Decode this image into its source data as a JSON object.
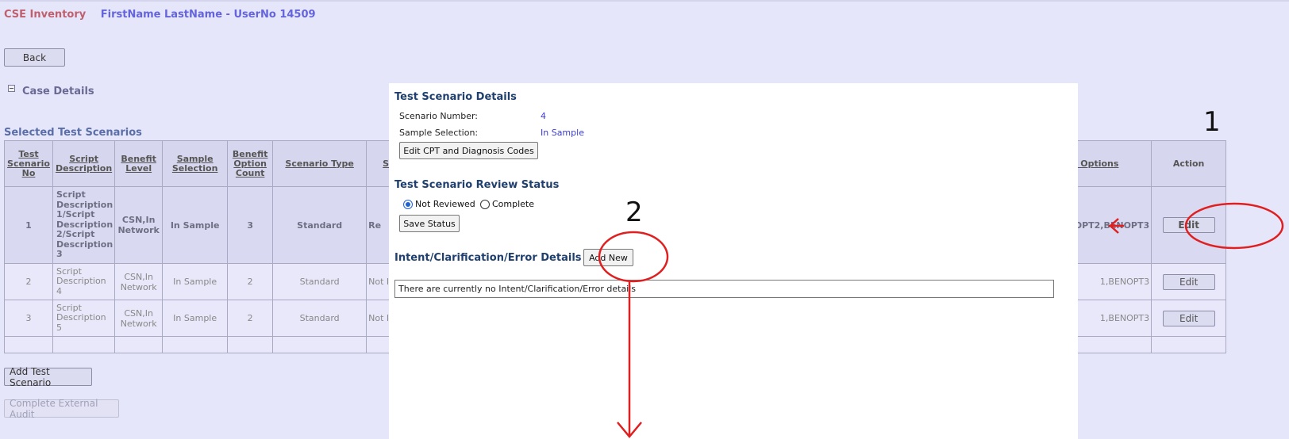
{
  "header": {
    "app_title": "CSE Inventory",
    "user_info": "FirstName LastName - UserNo 14509"
  },
  "buttons": {
    "back": "Back",
    "add_test_scenario": "Add Test Scenario",
    "complete_external_audit": "Complete External Audit"
  },
  "case_details": {
    "label": "Case Details"
  },
  "scenarios": {
    "title": "Selected Test Scenarios",
    "columns": {
      "scenario_no": "Test Scenario No",
      "script_description": "Script Description",
      "benefit_level": "Benefit Level",
      "sample_selection": "Sample Selection",
      "benefit_option_count": "Benefit Option Count",
      "scenario_type": "Scenario Type",
      "status_partial": "S",
      "options_partial": "t Options",
      "action": "Action"
    },
    "rows": [
      {
        "no": "1",
        "description": "Script Description 1/Script Description 2/Script Description 3",
        "benefit_level": "CSN,In Network",
        "sample_selection": "In Sample",
        "option_count": "3",
        "scenario_type": "Standard",
        "status_partial": "Re",
        "options_partial": "OPT2,BENOPT3",
        "action": "Edit"
      },
      {
        "no": "2",
        "description": "Script Description 4",
        "benefit_level": "CSN,In Network",
        "sample_selection": "In Sample",
        "option_count": "2",
        "scenario_type": "Standard",
        "status_partial": "Not I",
        "options_partial": "1,BENOPT3",
        "action": "Edit"
      },
      {
        "no": "3",
        "description": "Script Description 5",
        "benefit_level": "CSN,In Network",
        "sample_selection": "In Sample",
        "option_count": "2",
        "scenario_type": "Standard",
        "status_partial": "Not I",
        "options_partial": "1,BENOPT3",
        "action": "Edit"
      }
    ]
  },
  "popup": {
    "details_title": "Test Scenario Details",
    "scenario_number_label": "Scenario Number:",
    "scenario_number_value": "4",
    "sample_selection_label": "Sample Selection:",
    "sample_selection_value": "In Sample",
    "edit_codes_button": "Edit CPT and Diagnosis Codes",
    "review_status_title": "Test Scenario Review Status",
    "radio_not_reviewed": "Not Reviewed",
    "radio_complete": "Complete",
    "selected_status": "Not Reviewed",
    "save_status_button": "Save Status",
    "intent_title": "Intent/Clarification/Error Details",
    "add_new_button": "Add New",
    "no_details_text": "There are currently no Intent/Clarification/Error details"
  },
  "annotations": {
    "marker_1": "1",
    "marker_2": "2",
    "color": "#e02020"
  }
}
